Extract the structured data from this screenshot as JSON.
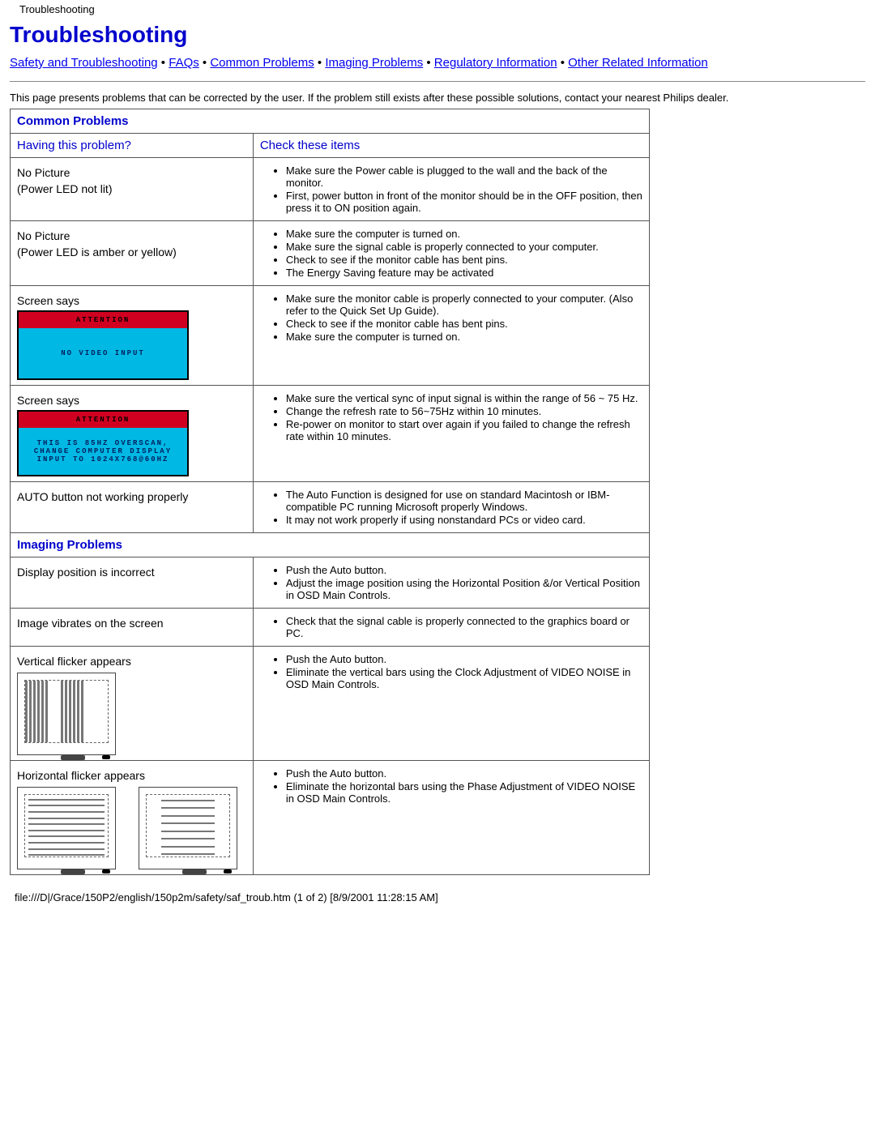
{
  "page_header": "Troubleshooting",
  "title": "Troubleshooting",
  "breadcrumb": {
    "items": [
      "Safety and Troubleshooting",
      "FAQs",
      "Common Problems",
      "Imaging Problems",
      "Regulatory Information",
      "Other Related Information"
    ],
    "sep": " • "
  },
  "intro": "This page presents problems that can be corrected by the user. If the problem still exists after these possible solutions, contact your nearest Philips dealer.",
  "sections": {
    "common": {
      "heading": "Common Problems",
      "col_left": "Having this problem?",
      "col_right": "Check these items",
      "rows": [
        {
          "problem_lines": [
            "No Picture",
            "(Power LED not lit)"
          ],
          "checks": [
            "Make sure the Power cable is plugged to the wall and the back of the monitor.",
            "First, power button in front of the monitor should be in the OFF position, then press it to ON position again."
          ]
        },
        {
          "problem_lines": [
            "No Picture",
            "(Power LED is amber or yellow)"
          ],
          "checks": [
            "Make sure the computer is turned on.",
            "Make sure the signal cable is properly connected to your computer.",
            "Check to see if the monitor cable has bent pins.",
            "The Energy Saving feature may be activated"
          ]
        },
        {
          "problem_lines": [
            "Screen says"
          ],
          "warn": {
            "top": "ATTENTION",
            "body": "NO VIDEO INPUT"
          },
          "checks": [
            "Make sure the monitor cable is properly connected to your computer. (Also refer to the Quick Set Up Guide).",
            "Check to see if the monitor cable has bent pins.",
            "Make sure the computer is turned on."
          ]
        },
        {
          "problem_lines": [
            "Screen says"
          ],
          "warn": {
            "top": "ATTENTION",
            "body": "THIS IS 85HZ OVERSCAN,\nCHANGE COMPUTER DISPLAY\nINPUT TO 1024X768@60HZ"
          },
          "checks": [
            "Make sure the vertical sync of input signal is within the range of 56 ~ 75 Hz.",
            "Change the refresh rate to 56~75Hz within 10 minutes.",
            "Re-power on monitor to start over again if you failed to change the refresh rate within 10 minutes."
          ]
        },
        {
          "problem_lines": [
            "AUTO button not working properly"
          ],
          "checks": [
            "The Auto Function is designed for use on standard Macintosh or IBM-compatible PC running Microsoft properly Windows.",
            "It may not work properly if using nonstandard PCs or video card."
          ]
        }
      ]
    },
    "imaging": {
      "heading": "Imaging Problems",
      "rows": [
        {
          "problem_lines": [
            "Display position is incorrect"
          ],
          "checks": [
            "Push the Auto button.",
            "Adjust the image position using the Horizontal Position &/or Vertical Position in OSD Main Controls."
          ]
        },
        {
          "problem_lines": [
            "Image vibrates on the screen"
          ],
          "checks": [
            "Check that the signal cable is properly connected to the graphics board or PC."
          ]
        },
        {
          "problem_lines": [
            "Vertical flicker appears"
          ],
          "graphic": "vflicker",
          "checks": [
            "Push the Auto button.",
            "Eliminate the vertical bars using the Clock Adjustment of VIDEO NOISE in OSD Main Controls."
          ]
        },
        {
          "problem_lines": [
            "Horizontal flicker appears"
          ],
          "graphic": "hflicker",
          "checks": [
            "Push the Auto button.",
            "Eliminate the horizontal bars using the Phase Adjustment of VIDEO NOISE in OSD Main Controls."
          ]
        }
      ]
    }
  },
  "footer": "file:///D|/Grace/150P2/english/150p2m/safety/saf_troub.htm (1 of 2) [8/9/2001 11:28:15 AM]"
}
